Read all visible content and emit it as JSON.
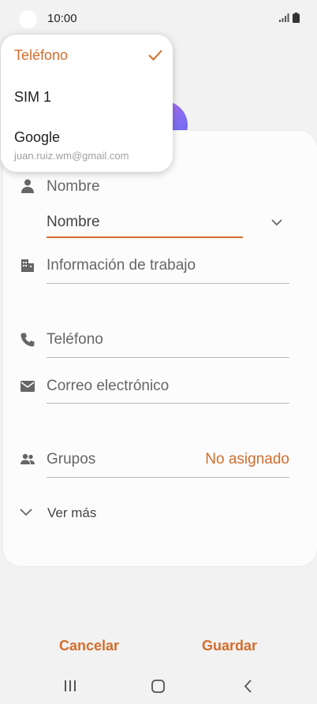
{
  "status": {
    "time": "10:00"
  },
  "dropdown": {
    "items": [
      {
        "label": "Teléfono",
        "selected": true
      },
      {
        "label": "SIM 1"
      },
      {
        "label": "Google",
        "sublabel": "juan.ruiz.wm@gmail.com"
      }
    ],
    "check_icon": "check-icon"
  },
  "form": {
    "name_section_label": "Nombre",
    "name_field_placeholder": "Nombre",
    "work_label": "Información de trabajo",
    "phone_label": "Teléfono",
    "email_label": "Correo electrónico",
    "groups_label": "Grupos",
    "groups_value": "No asignado",
    "more_label": "Ver más"
  },
  "actions": {
    "cancel_label": "Cancelar",
    "save_label": "Guardar"
  },
  "colors": {
    "accent": "#d36d2c",
    "background": "#f2f2f2",
    "card": "#fcfcfc"
  }
}
